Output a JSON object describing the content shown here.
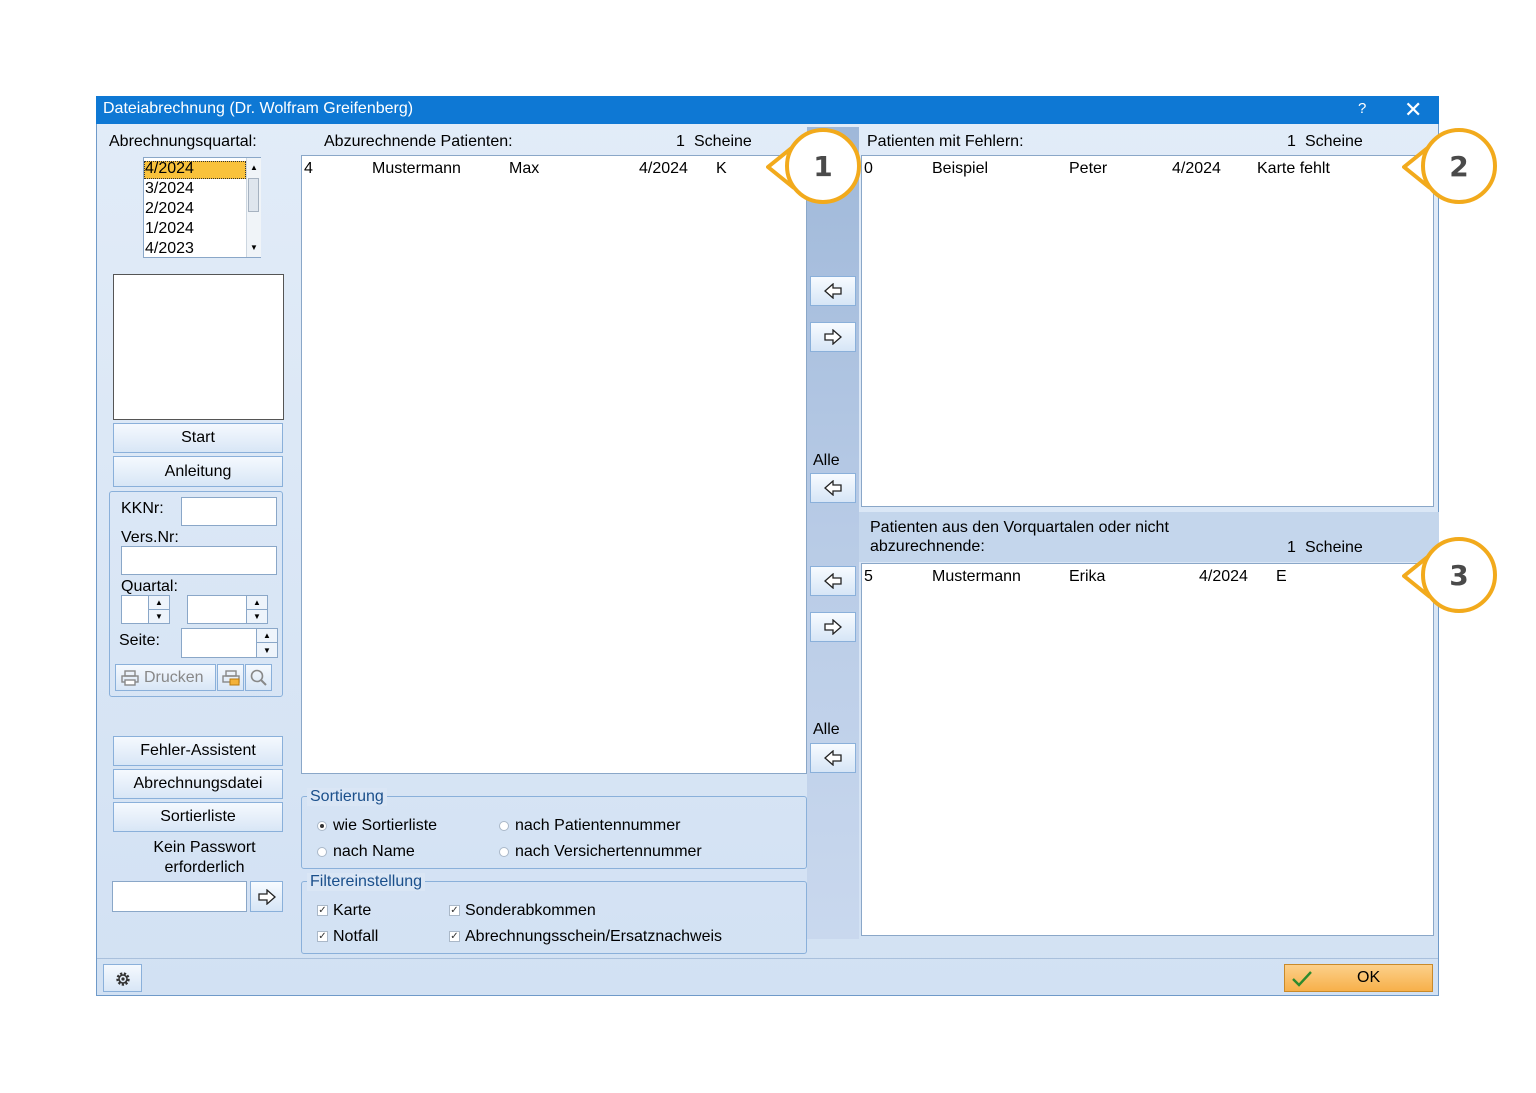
{
  "window": {
    "title": "Dateiabrechnung (Dr. Wolfram Greifenberg)",
    "help": "?",
    "close": "✕"
  },
  "left": {
    "quarter_label": "Abrechnungsquartal:",
    "quarters": [
      "4/2024",
      "3/2024",
      "2/2024",
      "1/2024",
      "4/2023"
    ],
    "selected_quarter": "4/2024",
    "start": "Start",
    "anleitung": "Anleitung",
    "kknr_label": "KKNr:",
    "versnr_label": "Vers.Nr:",
    "quartal_label": "Quartal:",
    "seite_label": "Seite:",
    "drucken": "Drucken",
    "fehler_assistent": "Fehler-Assistent",
    "abrechnungsdatei": "Abrechnungsdatei",
    "sortierliste": "Sortierliste",
    "password_line1": "Kein Passwort",
    "password_line2": "erforderlich"
  },
  "center": {
    "header": "Abzurechnende Patienten:",
    "count": "1",
    "count_unit": "Scheine",
    "rows": [
      {
        "nr": "4",
        "name": "Mustermann",
        "vorname": "Max",
        "quartal": "4/2024",
        "status": "K"
      }
    ],
    "sortierung": {
      "title": "Sortierung",
      "options": [
        "wie Sortierliste",
        "nach Patientennummer",
        "nach Name",
        "nach Versichertennummer"
      ],
      "selected": "wie Sortierliste"
    },
    "filter": {
      "title": "Filtereinstellung",
      "options": [
        "Karte",
        "Sonderabkommen",
        "Notfall",
        "Abrechnungsschein/Ersatznachweis"
      ]
    }
  },
  "middle": {
    "alle_1": "Alle",
    "alle_2": "Alle"
  },
  "right_top": {
    "header": "Patienten mit Fehlern:",
    "count": "1",
    "count_unit": "Scheine",
    "rows": [
      {
        "nr": "0",
        "name": "Beispiel",
        "vorname": "Peter",
        "quartal": "4/2024",
        "status": "Karte fehlt"
      }
    ]
  },
  "right_bottom": {
    "header_line1": "Patienten aus den Vorquartalen oder nicht",
    "header_line2": "abzurechnende:",
    "count": "1",
    "count_unit": "Scheine",
    "rows": [
      {
        "nr": "5",
        "name": "Mustermann",
        "vorname": "Erika",
        "quartal": "4/2024",
        "status": "E"
      }
    ]
  },
  "footer": {
    "ok": "OK"
  },
  "callouts": [
    "1",
    "2",
    "3"
  ],
  "colors": {
    "titlebar": "#0e78d4",
    "callout": "#f2aa1c",
    "ok_button": "#f7b04a"
  }
}
